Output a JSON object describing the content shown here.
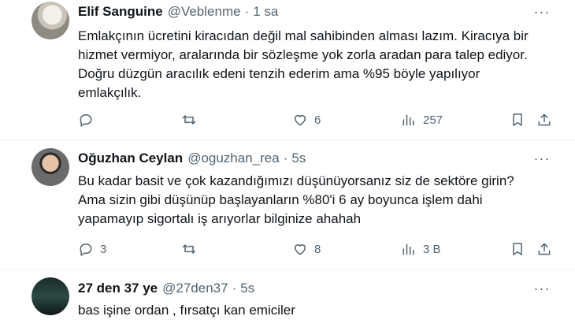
{
  "tweets": [
    {
      "name": "Elif Sanguine",
      "handle": "@Veblenme",
      "separator": "·",
      "time": "1 sa",
      "text": "Emlakçının ücretini kiracıdan değil mal sahibinden alması lazım. Kiracıya bir\nhizmet vermiyor, aralarında bir sözleşme yok zorla aradan para talep ediyor.\nDoğru düzgün aracılık edeni tenzih ederim ama %95 böyle yapılıyor\nemlakçılık.",
      "replies": "",
      "retweets": "",
      "likes": "6",
      "views": "257"
    },
    {
      "name": "Oğuzhan Ceylan",
      "handle": "@oguzhan_rea",
      "separator": "·",
      "time": "5s",
      "text": "Bu kadar basit ve çok kazandığımızı düşünüyorsanız siz de sektöre girin?\nAma sizin gibi düşünüp başlayanların %80'i 6 ay boyunca işlem dahi\nyapamayıp sigortalı iş arıyorlar bilginize ahahah",
      "replies": "3",
      "retweets": "",
      "likes": "8",
      "views": "3 B"
    },
    {
      "name": "27 den 37 ye",
      "handle": "@27den37",
      "separator": "·",
      "time": "5s",
      "text": "bas işine ordan , fırsatçı kan emiciler"
    }
  ],
  "more_glyph": "···"
}
